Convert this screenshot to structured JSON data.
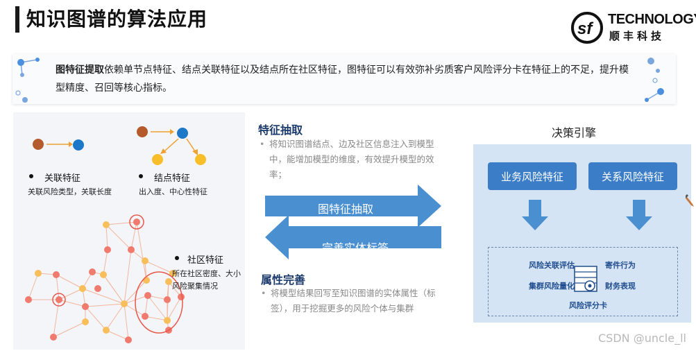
{
  "header": {
    "title": "知识图谱的算法应用",
    "logo_text": "TECHNOLOGY",
    "logo_cn": "顺丰科技"
  },
  "intro": {
    "bold": "图特征提取",
    "text": "依赖单节点特征、结点关联特征以及结点所在社区特征，图特征可以有效弥补劣质客户风险评分卡在特征上的不足，提升模型精度、召回等核心指标。"
  },
  "left_panel": {
    "relation": {
      "title": "关联特征",
      "sub": "关联风险类型，关联长度"
    },
    "node": {
      "title": "结点特征",
      "sub": "出入度、中心性特征"
    },
    "community": {
      "title": "社区特征",
      "sub1": "所在社区密度、大小",
      "sub2": "风险聚集情况"
    }
  },
  "middle": {
    "extract_title": "特征抽取",
    "extract_text": "将知识图谱结点、边及社区信息注入到模型中，能增加模型的维度，有效提升模型的效率；",
    "arrow_right": "图特征抽取",
    "arrow_left": "完善实体标签",
    "complete_title": "属性完善",
    "complete_text": "将模型结果回写至知识图谱的实体属性（标签），用于挖掘更多的风险个体与集群"
  },
  "right_panel": {
    "title": "决策引擎",
    "feature_business": "业务风险特征",
    "feature_relation": "关系风险特征",
    "items": {
      "risk_assoc": "风险关联评估",
      "mail": "寄件行为",
      "cluster": "集群风险量化",
      "finance": "财务表现",
      "scorecard": "风险评分卡"
    }
  },
  "watermark": "CSDN @uncle_ll",
  "colors": {
    "accent_blue": "#3b7ec7",
    "arrow_blue": "#4a8fd0",
    "node_red": "#f07a6e",
    "node_orange": "#f8be5a",
    "node_brown": "#b55a2a",
    "node_blue": "#1e78c8"
  }
}
